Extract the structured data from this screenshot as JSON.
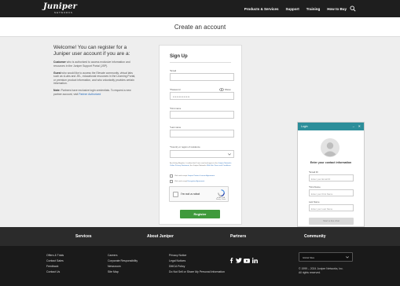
{
  "nav": {
    "logo_main": "Juniper",
    "logo_sub": "NETWORKS",
    "links": [
      "Products & Services",
      "Support",
      "Training",
      "How to Buy"
    ]
  },
  "page_title": "Create an account",
  "intro": {
    "heading": "Welcome! You can register for a Juniper user account if you are a:",
    "customer_label": "Customer",
    "customer_text": " who is authorized to access exclusive information and resources in the Juniper Support Portal (JSP).",
    "guest_label": "Guest",
    "guest_text": " who would like to access the Elevate community, virtual labs such as vLabs and JEL, educational resources in the Learning Portal, or premium product information, and who voluntarily provides certain information.",
    "note_label": "Note:",
    "note_text": " Partners have exclusive login credentials. To request a new partner account, visit ",
    "note_link": "Partner Authorized"
  },
  "signup": {
    "title": "Sign Up",
    "email_label": "*Email",
    "email_value": "",
    "password_label": "*Password",
    "password_value": "••••••••••••••",
    "show_label": "Show",
    "first_name_label": "*First name",
    "last_name_label": "*Last name",
    "country_label": "*Country or region of residence",
    "consent_text": "By clicking Register, I confirm that I have read and agree to the ",
    "consent_link1": "Juniper Networks Online Privacy Statement",
    "consent_mid": ", the Juniper Networks ",
    "consent_link2": "Web Site Terms and Conditions",
    "consent_end": ".",
    "check1_text": "Click and accept ",
    "check1_link": "Juniper Partner License Agreement",
    "check2_text": "Click and accept ",
    "check2_link": "Encryption Agreement",
    "captcha_text": "I'm not a robot",
    "captcha_brand": "reCAPTCHA Privacy - Terms",
    "register_label": "Register"
  },
  "chat": {
    "title": "Login",
    "min": "–",
    "close": "✕",
    "heading": "Enter your contact information",
    "email_label": "*Email ID",
    "email_placeholder": "Enter your Email ID",
    "first_label": "*First Name",
    "first_placeholder": "Enter your First Name",
    "last_label": "Last Name",
    "last_placeholder": "Enter your Last Name",
    "button_label": "Start a live chat"
  },
  "footer": {
    "headings": [
      "Services",
      "About Juniper",
      "Partners",
      "Community"
    ],
    "col1": [
      "Offers & Trials",
      "Contact Sales",
      "Feedback",
      "Contact Us"
    ],
    "col2": [
      "Careers",
      "Corporate Responsibility",
      "Newsroom",
      "Site Map"
    ],
    "col3": [
      "Privacy Notice",
      "Legal Notices",
      "DMCA Policy",
      "Do Not Sell or Share My Personal Information"
    ],
    "language": "Global Sites",
    "copyright_line1": "© 1999 – 2024 Juniper Networks, Inc.",
    "copyright_line2": "All rights reserved."
  },
  "colors": {
    "nav_bg": "#1e1e1e",
    "register_green": "#3f9a3c",
    "chat_teal": "#2c8e9a",
    "link_blue": "#2a6ebb"
  },
  "icons": [
    "search-icon",
    "eye-icon",
    "chevron-down-icon",
    "recaptcha-icon",
    "user-avatar-icon",
    "facebook-icon",
    "twitter-icon",
    "youtube-icon",
    "linkedin-icon"
  ]
}
